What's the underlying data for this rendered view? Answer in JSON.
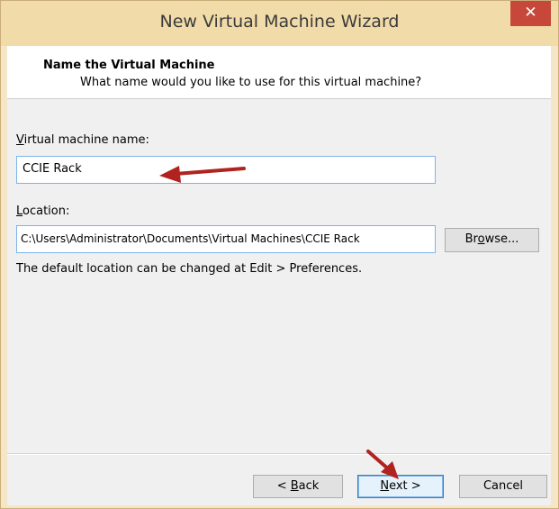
{
  "window": {
    "title": "New Virtual Machine Wizard",
    "close_glyph": "✕"
  },
  "header": {
    "title": "Name the Virtual Machine",
    "subtitle": "What name would you like to use for this virtual machine?"
  },
  "vm_name": {
    "label_mnemonic": "V",
    "label_rest": "irtual machine name:",
    "value": "CCIE Rack"
  },
  "location": {
    "label_mnemonic": "L",
    "label_rest": "ocation:",
    "value": "C:\\Users\\Administrator\\Documents\\Virtual Machines\\CCIE Rack",
    "browse_pre": "Br",
    "browse_mnemonic": "o",
    "browse_post": "wse..."
  },
  "hint": "The default location can be changed at Edit > Preferences.",
  "buttons": {
    "back_pre": "< ",
    "back_mnemonic": "B",
    "back_post": "ack",
    "next_mnemonic": "N",
    "next_post": "ext >",
    "cancel": "Cancel"
  },
  "colors": {
    "annotation_arrow": "#b0231f",
    "titlebar": "#f1dba8",
    "close_button": "#c7483a"
  }
}
